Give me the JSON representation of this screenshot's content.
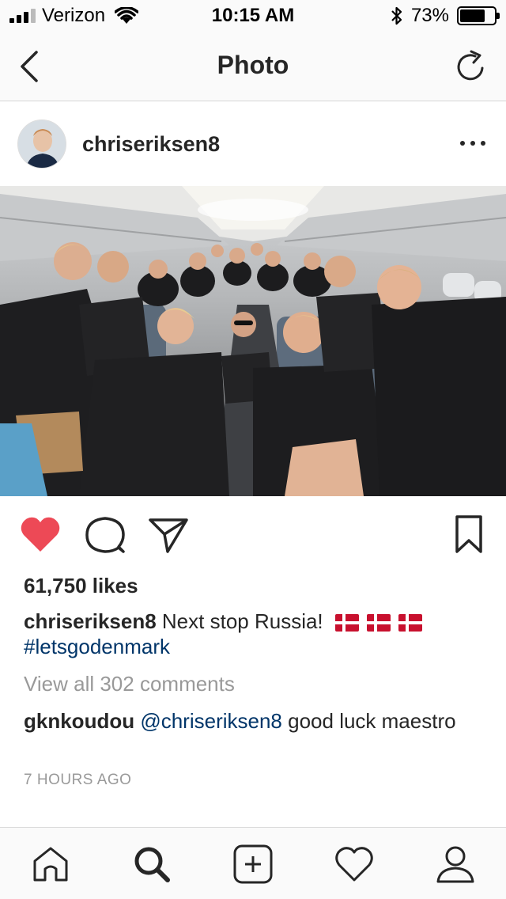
{
  "status_bar": {
    "carrier": "Verizon",
    "time": "10:15 AM",
    "battery_percent": "73%",
    "battery_level": 0.73,
    "signal_bars": 3
  },
  "nav": {
    "title": "Photo"
  },
  "post": {
    "username": "chriseriksen8",
    "likes_text": "61,750 likes",
    "caption": {
      "username": "chriseriksen8",
      "text": "Next stop Russia!",
      "hashtag": "#letsgodenmark",
      "flag_count": 3
    },
    "view_comments": "View all 302 comments",
    "comment": {
      "username": "gknkoudou",
      "mention": "@chriseriksen8",
      "text": "good luck maestro"
    },
    "timestamp": "7 HOURS AGO",
    "liked": true
  },
  "colors": {
    "like_red": "#ed4956",
    "link_blue": "#003569",
    "muted_gray": "#999999",
    "text": "#262626"
  },
  "icons": {
    "back": "chevron-left-icon",
    "refresh": "refresh-icon",
    "more": "more-icon",
    "like": "heart-icon",
    "comment": "comment-icon",
    "share": "send-icon",
    "save": "bookmark-icon",
    "home": "home-icon",
    "search": "search-icon",
    "add": "add-post-icon",
    "activity": "heart-outline-icon",
    "profile": "profile-icon"
  }
}
